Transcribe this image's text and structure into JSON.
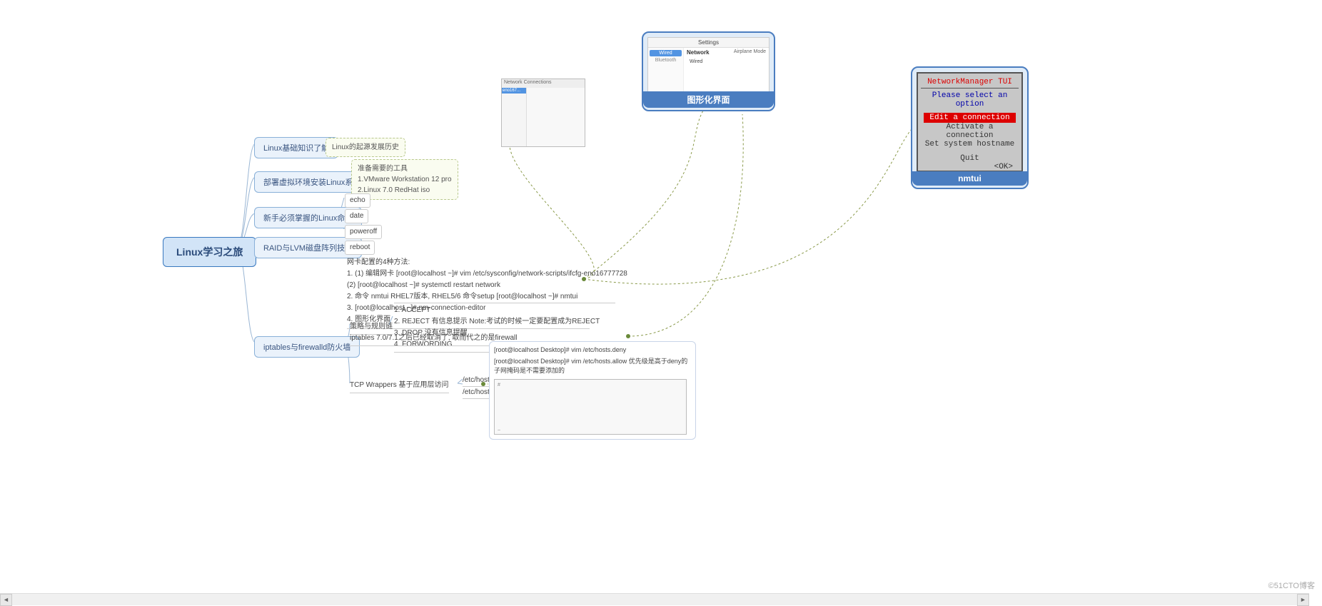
{
  "root": {
    "title": "Linux学习之旅"
  },
  "branches": {
    "b1": "Linux基础知识了解",
    "b2": "部署虚拟环境安装Linux系统",
    "b3": "新手必须掌握的Linux命令",
    "b4": "RAID与LVM磁盘阵列技术",
    "b5": "iptables与firewalld防火墙"
  },
  "notes": {
    "n1": "Linux的起源发展历史",
    "n2_title": "准备需要的工具",
    "n2_l1": "1.VMware Workstation 12 pro",
    "n2_l2": "2.Linux 7.0 RedHat iso"
  },
  "cmds": {
    "c1": "echo",
    "c2": "date",
    "c3": "poweroff",
    "c4": "reboot"
  },
  "netcfg": {
    "title": "网卡配置的4种方法:",
    "l1": "1.   (1) 编辑网卡 [root@localhost ~]# vim /etc/sysconfig/network-scripts/ifcfg-eno16777728",
    "l2": "      (2) [root@localhost ~]# systemctl restart network",
    "l3": "2. 命令 nmtui RHEL7版本, RHEL5/6 命令setup [root@localhost ~]# nmtui",
    "l4": "3. [root@localhost ~]# nm-connection-editor",
    "l5": "4. 图形化界面"
  },
  "policy": {
    "label": "策略与规则链",
    "l1": "1. ACCEPT",
    "l2": "2. REJECT 有信息提示     Note:考试的时候一定要配置成为REJECT",
    "l3": "3. DROP 没有信息提醒",
    "l4": "4. FORWORDING"
  },
  "ipt": "iptables 7.0/7.1之后已经取消了, 取而代之的是firewall",
  "tcpw": {
    "label": "TCP Wrappers 基于应用层访问",
    "f1": "/etc/hosts.deny",
    "f2": "/etc/hosts.allow"
  },
  "hosts": {
    "l1": "[root@localhost Desktop]# vim /etc/hosts.deny",
    "l2": "[root@localhost Desktop]# vim /etc/hosts.allow 优先级是高于deny的 子网掩码是不需要添加的"
  },
  "groups": {
    "gui": "图形化界面",
    "nmtui": "nmtui"
  },
  "tui": {
    "title": "NetworkManager TUI",
    "prompt": "Please select an option",
    "o1": "Edit a connection",
    "o2": "Activate a connection",
    "o3": "Set system hostname",
    "quit": "Quit",
    "ok": "<OK>"
  },
  "gui_settings": {
    "title": "Settings",
    "tab": "Network",
    "wired": "Wired",
    "airplane": "Airplane Mode"
  },
  "watermark": "©51CTO博客",
  "scroll": {
    "left": "◄",
    "right": "►"
  }
}
